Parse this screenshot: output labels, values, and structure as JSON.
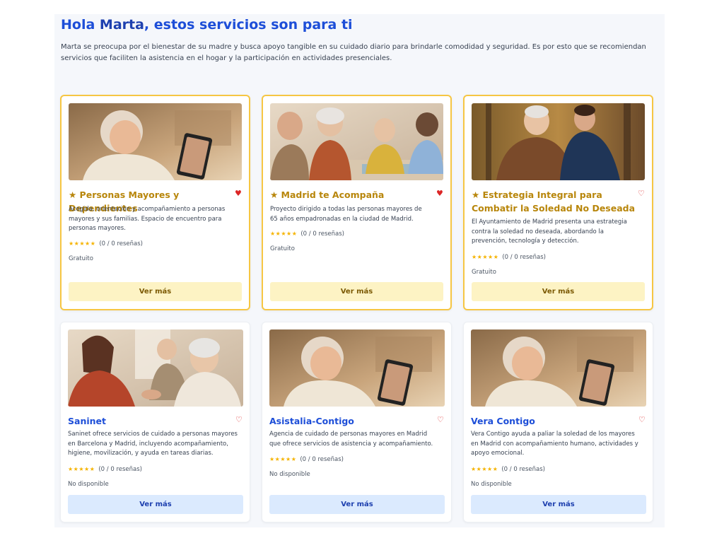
{
  "header": {
    "greeting_prefix": "Hola ",
    "user_name": "Marta",
    "greeting_suffix": ", estos servicios son para ti",
    "intro": "Marta se preocupa por el bienestar de su madre y busca apoyo tangible en su cuidado diario para brindarle comodidad y seguridad. Es por esto que se recomiendan servicios que faciliten la asistencia en el hogar y la participación en actividades presenciales."
  },
  "colors": {
    "featured_border": "#f6c643",
    "featured_title": "#b8860b",
    "featured_button": "#fdf3c4",
    "plain_title": "#1d4ed8",
    "plain_button": "#dbeafe",
    "heart": "#dc2626",
    "star": "#f5b301"
  },
  "icons": {
    "star": "★",
    "heart_filled": "♥",
    "heart_outline": "♡"
  },
  "cards": [
    {
      "title": "★ Personas Mayores y Dependientes",
      "description": "Acogida, orientación y acompañamiento a personas mayores y sus familias. Espacio de encuentro para personas mayores.",
      "stars": "★★★★★",
      "rating": "(0 / 0 reseñas)",
      "price": "Gratuito",
      "button": "Ver más",
      "heart": "♥",
      "favorite": true,
      "image": "elderly-woman-video-call-tablet"
    },
    {
      "title": "★ Madrid te Acompaña",
      "description": "Proyecto dirigido a todas las personas mayores de 65 años empadronadas en la ciudad de Madrid.",
      "stars": "★★★★★",
      "rating": "(0 / 0 reseñas)",
      "price": "Gratuito",
      "button": "Ver más",
      "heart": "♥",
      "favorite": true,
      "image": "seniors-painting-group"
    },
    {
      "title": "★ Estrategia Integral para Combatir la Soledad No Deseada",
      "description": "El Ayuntamiento de Madrid presenta una estrategia contra la soledad no deseada, abordando la prevención, tecnología y detección.",
      "stars": "★★★★★",
      "rating": "(0 / 0 reseñas)",
      "price": "Gratuito",
      "button": "Ver más",
      "heart": "♡",
      "favorite": false,
      "image": "elderly-man-walking-with-young-man"
    },
    {
      "title": "Saninet",
      "description": "Saninet ofrece servicios de cuidado a personas mayores en Barcelona y Madrid, incluyendo acompañamiento, higiene, movilización, y ayuda en tareas diarias.",
      "stars": "★★★★★",
      "rating": "(0 / 0 reseñas)",
      "price": "No disponible",
      "button": "Ver más",
      "heart": "♡",
      "favorite": false,
      "image": "caregiver-holding-hands-elderly-couple"
    },
    {
      "title": "Asistalia-Contigo",
      "description": "Agencia de cuidado de personas mayores en Madrid que ofrece servicios de asistencia y acompañamiento.",
      "stars": "★★★★★",
      "rating": "(0 / 0 reseñas)",
      "price": "No disponible",
      "button": "Ver más",
      "heart": "♡",
      "favorite": false,
      "image": "elderly-woman-video-call-tablet"
    },
    {
      "title": "Vera Contigo",
      "description": "Vera Contigo ayuda a paliar la soledad de los mayores en Madrid con acompañamiento humano, actividades y apoyo emocional.",
      "stars": "★★★★★",
      "rating": "(0 / 0 reseñas)",
      "price": "No disponible",
      "button": "Ver más",
      "heart": "♡",
      "favorite": false,
      "image": "elderly-woman-video-call-tablet"
    }
  ]
}
